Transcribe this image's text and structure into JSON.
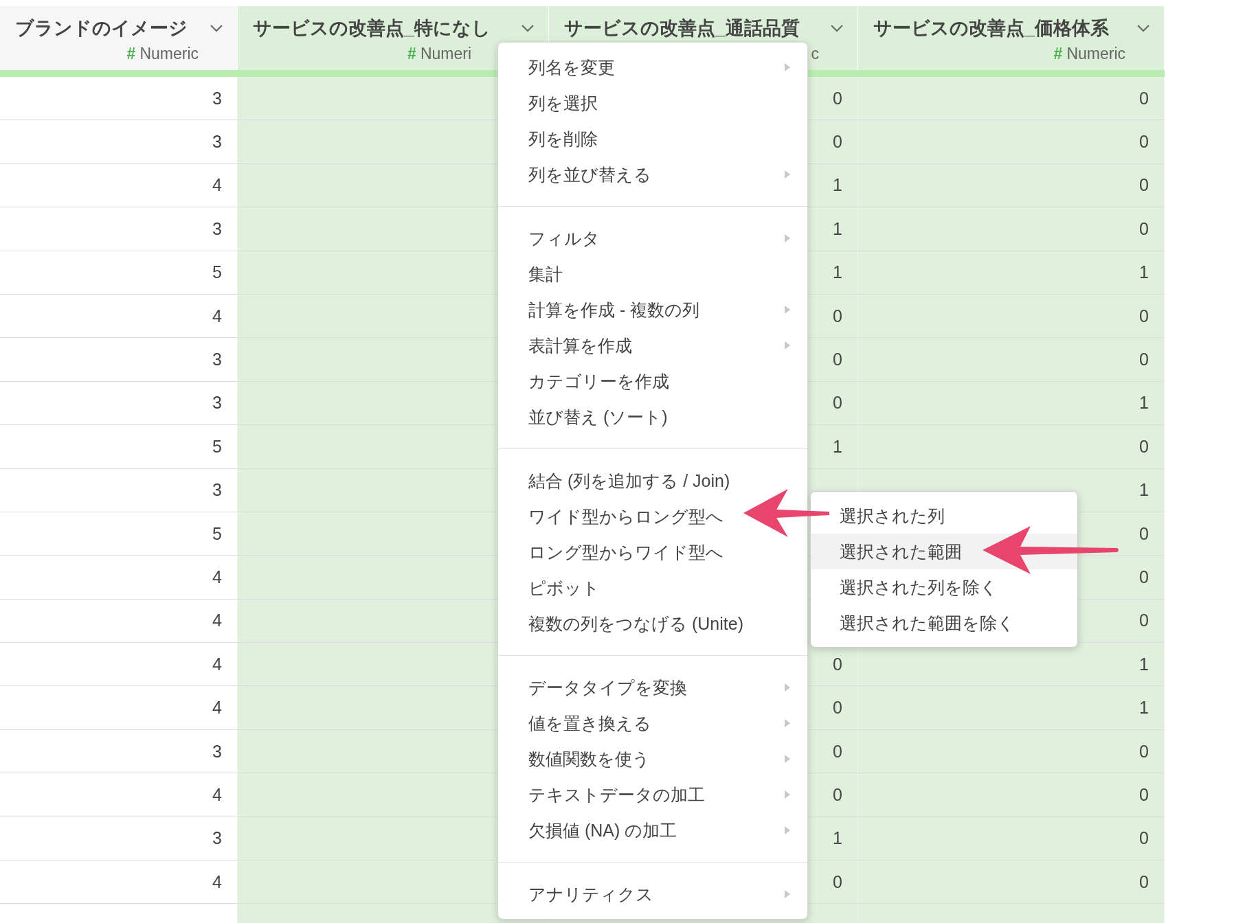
{
  "table": {
    "columns": [
      {
        "title": "ブランドのイメージ",
        "type_mark": "#",
        "type_label": "Numeric",
        "highlighted": false
      },
      {
        "title": "サービスの改善点_特になし",
        "type_mark": "#",
        "type_label": "Numeri",
        "highlighted": true
      },
      {
        "title": "サービスの改善点_通話品質",
        "type_label": "c",
        "highlighted": true
      },
      {
        "title": "サービスの改善点_価格体系",
        "type_mark": "#",
        "type_label": "Numeric",
        "highlighted": true
      }
    ],
    "rows": [
      [
        "3",
        null,
        "0",
        "0"
      ],
      [
        "3",
        null,
        "0",
        "0"
      ],
      [
        "4",
        null,
        "1",
        "0"
      ],
      [
        "3",
        null,
        "1",
        "0"
      ],
      [
        "5",
        null,
        "1",
        "1"
      ],
      [
        "4",
        null,
        "0",
        "0"
      ],
      [
        "3",
        null,
        "0",
        "0"
      ],
      [
        "3",
        null,
        "0",
        "1"
      ],
      [
        "5",
        null,
        "1",
        "0"
      ],
      [
        "3",
        null,
        null,
        "1"
      ],
      [
        "5",
        null,
        null,
        "0"
      ],
      [
        "4",
        null,
        null,
        "0"
      ],
      [
        "4",
        null,
        null,
        "0"
      ],
      [
        "4",
        null,
        "0",
        "1"
      ],
      [
        "4",
        null,
        "0",
        "1"
      ],
      [
        "3",
        null,
        "0",
        "0"
      ],
      [
        "4",
        null,
        "0",
        "0"
      ],
      [
        "3",
        null,
        "1",
        "0"
      ],
      [
        "4",
        null,
        "0",
        "0"
      ]
    ]
  },
  "context_menu": {
    "groups": [
      [
        {
          "label": "列名を変更",
          "submenu": true
        },
        {
          "label": "列を選択",
          "submenu": false
        },
        {
          "label": "列を削除",
          "submenu": false
        },
        {
          "label": "列を並び替える",
          "submenu": true
        }
      ],
      [
        {
          "label": "フィルタ",
          "submenu": true
        },
        {
          "label": "集計",
          "submenu": false
        },
        {
          "label": "計算を作成 - 複数の列",
          "submenu": true
        },
        {
          "label": "表計算を作成",
          "submenu": true
        },
        {
          "label": "カテゴリーを作成",
          "submenu": false
        },
        {
          "label": "並び替え (ソート)",
          "submenu": false
        }
      ],
      [
        {
          "label": "結合 (列を追加する / Join)",
          "submenu": false
        },
        {
          "label": "ワイド型からロング型へ",
          "submenu": false
        },
        {
          "label": "ロング型からワイド型へ",
          "submenu": false
        },
        {
          "label": "ピボット",
          "submenu": false
        },
        {
          "label": "複数の列をつなげる (Unite)",
          "submenu": false
        }
      ],
      [
        {
          "label": "データタイプを変換",
          "submenu": true
        },
        {
          "label": "値を置き換える",
          "submenu": true
        },
        {
          "label": "数値関数を使う",
          "submenu": true
        },
        {
          "label": "テキストデータの加工",
          "submenu": true
        },
        {
          "label": "欠損値 (NA) の加工",
          "submenu": true
        }
      ],
      [
        {
          "label": "アナリティクス",
          "submenu": true
        }
      ]
    ]
  },
  "submenu": {
    "items": [
      {
        "label": "選択された列",
        "selected": false
      },
      {
        "label": "選択された範囲",
        "selected": true
      },
      {
        "label": "選択された列を除く",
        "selected": false
      },
      {
        "label": "選択された範囲を除く",
        "selected": false
      }
    ]
  }
}
